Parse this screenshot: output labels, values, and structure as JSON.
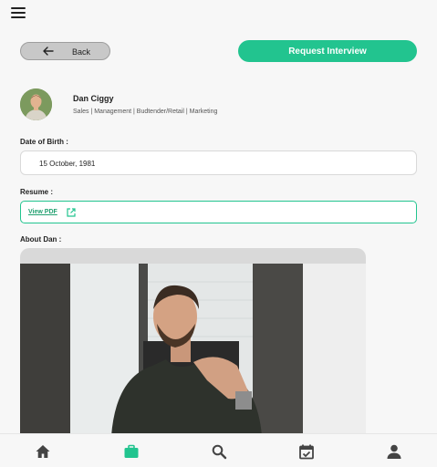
{
  "header": {
    "menu_icon": "hamburger-menu-icon"
  },
  "actions": {
    "back_label": "Back",
    "request_label": "Request Interview",
    "accent_color": "#22c48f"
  },
  "profile": {
    "name": "Dan Ciggy",
    "roles": "Sales | Management  | Budtender/Retail | Marketing"
  },
  "dob": {
    "label": "Date of Birth :",
    "value": "15 October, 1981"
  },
  "resume": {
    "label": "Resume :",
    "link_label": "View PDF",
    "icon": "external-link-icon"
  },
  "about": {
    "label": "About Dan :"
  },
  "nav": {
    "items": [
      {
        "icon": "home-icon",
        "active": false
      },
      {
        "icon": "briefcase-icon",
        "active": true
      },
      {
        "icon": "search-icon",
        "active": false
      },
      {
        "icon": "calendar-check-icon",
        "active": false
      },
      {
        "icon": "person-icon",
        "active": false
      }
    ]
  }
}
